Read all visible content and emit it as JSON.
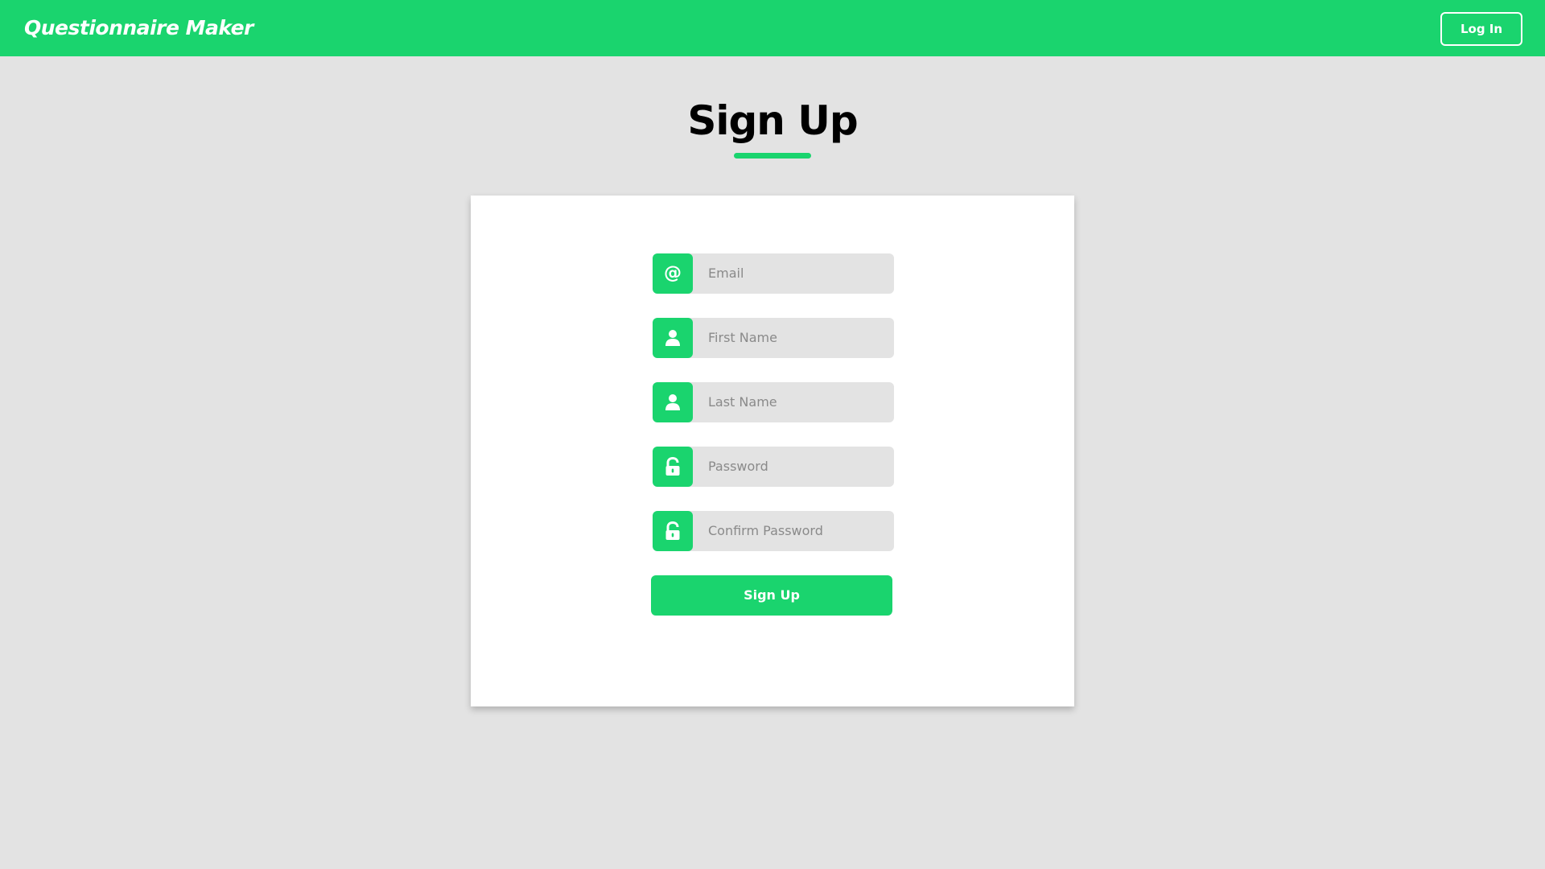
{
  "navbar": {
    "brand": "Questionnaire Maker",
    "login_label": "Log In"
  },
  "page": {
    "title": "Sign Up"
  },
  "form": {
    "fields": [
      {
        "placeholder": "Email",
        "icon": "at-icon"
      },
      {
        "placeholder": "First Name",
        "icon": "user-icon"
      },
      {
        "placeholder": "Last Name",
        "icon": "user-icon"
      },
      {
        "placeholder": "Password",
        "icon": "unlock-icon"
      },
      {
        "placeholder": "Confirm Password",
        "icon": "unlock-icon"
      }
    ],
    "submit_label": "Sign Up"
  },
  "colors": {
    "accent": "#1ad46e",
    "background": "#e3e3e3",
    "card": "#ffffff",
    "placeholder": "#8a8a8a"
  }
}
